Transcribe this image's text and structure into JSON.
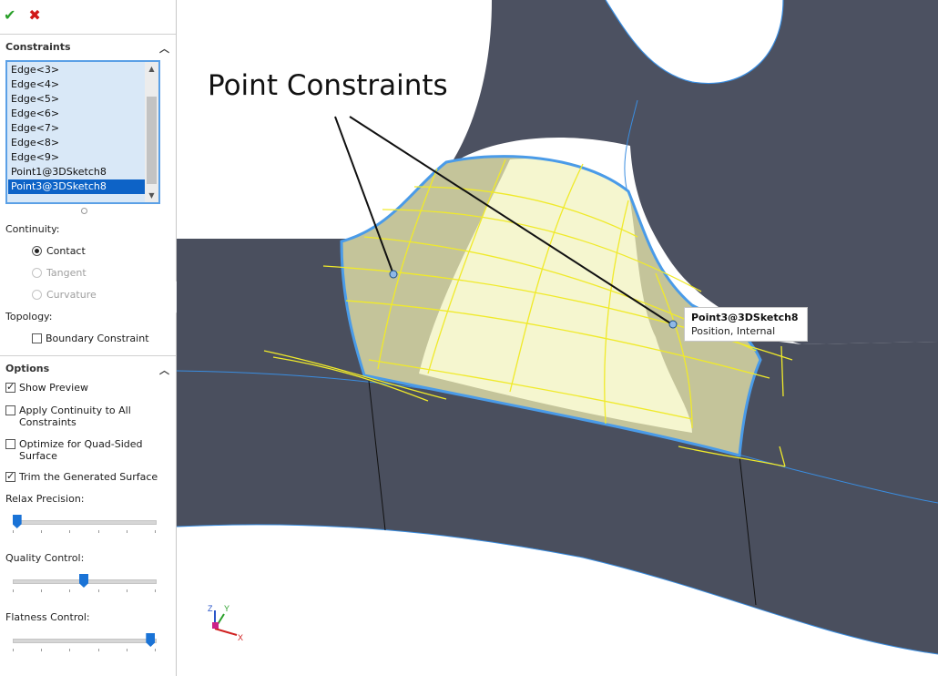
{
  "toolbar": {
    "ok_icon": "check-icon",
    "cancel_icon": "close-icon",
    "ok_glyph": "✔",
    "cancel_glyph": "✖"
  },
  "constraints": {
    "header": "Constraints",
    "items": [
      {
        "label": "Edge<3>",
        "selected": false
      },
      {
        "label": "Edge<4>",
        "selected": false
      },
      {
        "label": "Edge<5>",
        "selected": false
      },
      {
        "label": "Edge<6>",
        "selected": false
      },
      {
        "label": "Edge<7>",
        "selected": false
      },
      {
        "label": "Edge<8>",
        "selected": false
      },
      {
        "label": "Edge<9>",
        "selected": false
      },
      {
        "label": "Point1@3DSketch8",
        "selected": false
      },
      {
        "label": "Point3@3DSketch8",
        "selected": true
      }
    ],
    "continuity_label": "Continuity:",
    "continuity": [
      {
        "label": "Contact",
        "state": "selected"
      },
      {
        "label": "Tangent",
        "state": "disabled"
      },
      {
        "label": "Curvature",
        "state": "disabled"
      }
    ],
    "topology_label": "Topology:",
    "boundary_constraint": {
      "label": "Boundary Constraint",
      "checked": false
    }
  },
  "options": {
    "header": "Options",
    "show_preview": {
      "label": "Show Preview",
      "checked": true
    },
    "apply_continuity": {
      "label1": "Apply Continuity to All",
      "label2": "Constraints",
      "checked": false
    },
    "optimize_quad": {
      "label1": "Optimize for Quad-Sided",
      "label2": "Surface",
      "checked": false
    },
    "trim_surface": {
      "label": "Trim the Generated Surface",
      "checked": true
    },
    "relax_precision": {
      "label": "Relax Precision:",
      "value": 0.03
    },
    "quality_control": {
      "label": "Quality Control:",
      "value": 0.5
    },
    "flatness_control": {
      "label": "Flatness Control:",
      "value": 0.97
    }
  },
  "annotation": {
    "title": "Point Constraints"
  },
  "tooltip": {
    "title": "Point3@3DSketch8",
    "subtitle": "Position, Internal"
  },
  "triad": {
    "x": "X",
    "y": "Y",
    "z": "Z"
  },
  "colors": {
    "selection": "#0d63c7",
    "list_bg": "#d9e8f7",
    "surface_preview": "#f4f6c8",
    "edge_highlight": "#4a9be8",
    "curve": "#f0ea2a",
    "model": "#4a4f5e"
  }
}
